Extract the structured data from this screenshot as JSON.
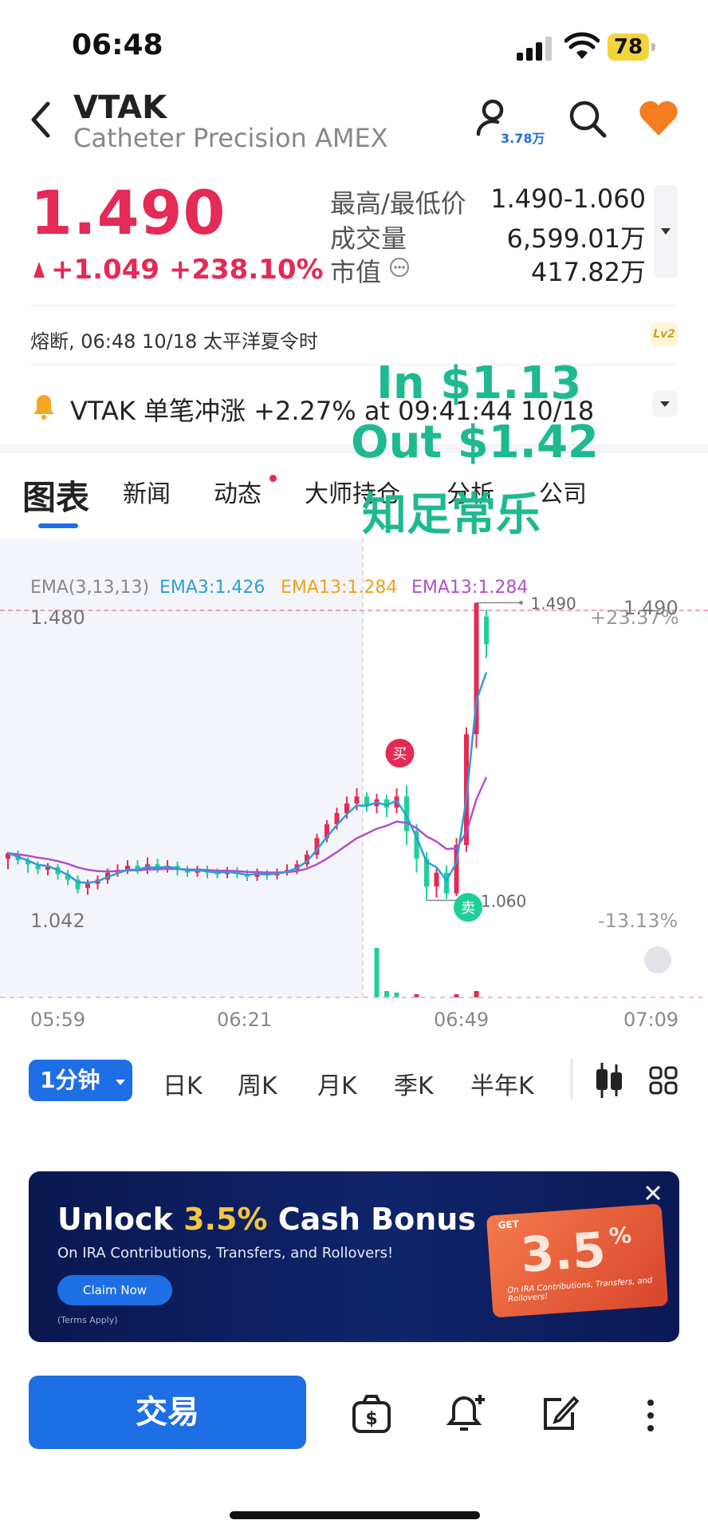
{
  "status_bar": {
    "time": "06:48",
    "battery": "78"
  },
  "header": {
    "ticker": "VTAK",
    "company": "Catheter Precision AMEX",
    "follow_count": "3.78万"
  },
  "quote": {
    "price": "1.490",
    "change": "+1.049 +238.10%",
    "stats": [
      {
        "label": "最高/最低价",
        "value": "1.490-1.060"
      },
      {
        "label": "成交量",
        "value": "6,599.01万"
      },
      {
        "label": "市值",
        "value": "417.82万"
      }
    ]
  },
  "halt_status": "熔断, 06:48 10/18 太平洋夏令时",
  "level_badge": "Lv2",
  "alert_text": "VTAK 单笔冲涨 +2.27% at 09:41:44 10/18",
  "overlay": {
    "line1": "In $1.13",
    "line2": "Out $1.42",
    "line3": "知足常乐"
  },
  "tabs": [
    "图表",
    "新闻",
    "动态",
    "大师持仓",
    "分析",
    "公司"
  ],
  "chart_data": {
    "type": "candlestick",
    "ema_labels": {
      "params": "EMA(3,13,13)",
      "ema3": "EMA3:1.426",
      "ema13a": "EMA13:1.284",
      "ema13b": "EMA13:1.284"
    },
    "ylim": [
      1.042,
      1.48
    ],
    "y_left_labels": [
      "1.480",
      "1.042"
    ],
    "y_right_labels": [
      "+23.37%",
      "-13.13%"
    ],
    "high_marker": "1.490",
    "low_marker": "1.060",
    "buy_label": "买",
    "sell_label": "卖",
    "x_ticks": [
      "05:59",
      "06:21",
      "06:49",
      "07:09"
    ],
    "colors": {
      "up": "#e42a55",
      "down": "#1fcf97",
      "ema3": "#2a9fd6",
      "ema13": "#b24fd0"
    },
    "candles": [
      [
        1.12,
        1.128,
        1.105,
        1.13
      ],
      [
        1.125,
        1.118,
        1.112,
        1.132
      ],
      [
        1.118,
        1.112,
        1.1,
        1.122
      ],
      [
        1.11,
        1.105,
        1.098,
        1.116
      ],
      [
        1.104,
        1.108,
        1.096,
        1.114
      ],
      [
        1.108,
        1.098,
        1.09,
        1.112
      ],
      [
        1.098,
        1.09,
        1.082,
        1.104
      ],
      [
        1.09,
        1.076,
        1.07,
        1.096
      ],
      [
        1.078,
        1.084,
        1.068,
        1.09
      ],
      [
        1.084,
        1.09,
        1.076,
        1.096
      ],
      [
        1.09,
        1.1,
        1.084,
        1.106
      ],
      [
        1.1,
        1.104,
        1.094,
        1.112
      ],
      [
        1.104,
        1.11,
        1.098,
        1.118
      ],
      [
        1.11,
        1.104,
        1.098,
        1.118
      ],
      [
        1.104,
        1.112,
        1.098,
        1.122
      ],
      [
        1.112,
        1.106,
        1.1,
        1.12
      ],
      [
        1.106,
        1.11,
        1.1,
        1.118
      ],
      [
        1.11,
        1.104,
        1.096,
        1.116
      ],
      [
        1.104,
        1.1,
        1.094,
        1.11
      ],
      [
        1.1,
        1.104,
        1.094,
        1.11
      ],
      [
        1.104,
        1.1,
        1.092,
        1.11
      ],
      [
        1.1,
        1.098,
        1.092,
        1.106
      ],
      [
        1.098,
        1.102,
        1.092,
        1.108
      ],
      [
        1.102,
        1.098,
        1.092,
        1.108
      ],
      [
        1.098,
        1.094,
        1.088,
        1.104
      ],
      [
        1.094,
        1.1,
        1.088,
        1.106
      ],
      [
        1.1,
        1.096,
        1.09,
        1.104
      ],
      [
        1.096,
        1.1,
        1.09,
        1.106
      ],
      [
        1.1,
        1.104,
        1.096,
        1.112
      ],
      [
        1.104,
        1.112,
        1.098,
        1.118
      ],
      [
        1.112,
        1.126,
        1.108,
        1.132
      ],
      [
        1.126,
        1.15,
        1.12,
        1.156
      ],
      [
        1.15,
        1.17,
        1.144,
        1.176
      ],
      [
        1.17,
        1.186,
        1.162,
        1.194
      ],
      [
        1.186,
        1.2,
        1.178,
        1.21
      ],
      [
        1.2,
        1.21,
        1.19,
        1.222
      ],
      [
        1.21,
        1.196,
        1.188,
        1.216
      ],
      [
        1.196,
        1.206,
        1.186,
        1.214
      ],
      [
        1.206,
        1.194,
        1.18,
        1.212
      ],
      [
        1.194,
        1.21,
        1.186,
        1.222
      ],
      [
        1.21,
        1.16,
        1.14,
        1.226
      ],
      [
        1.16,
        1.12,
        1.1,
        1.17
      ],
      [
        1.12,
        1.08,
        1.06,
        1.13
      ],
      [
        1.08,
        1.1,
        1.064,
        1.106
      ],
      [
        1.1,
        1.07,
        1.062,
        1.11
      ],
      [
        1.07,
        1.14,
        1.066,
        1.15
      ],
      [
        1.14,
        1.3,
        1.13,
        1.31
      ],
      [
        1.3,
        1.49,
        1.28,
        1.49
      ],
      [
        1.47,
        1.43,
        1.41,
        1.48
      ]
    ]
  },
  "periods": [
    "1分钟",
    "日K",
    "周K",
    "月K",
    "季K",
    "半年K"
  ],
  "banner": {
    "headline_a": "Unlock",
    "headline_b": "3.5%",
    "headline_c": "Cash Bonus",
    "sub": "On IRA Contributions, Transfers, and Rollovers!",
    "cta": "Claim Now",
    "fine": "(Terms Apply)",
    "card_get": "GET",
    "card_value": "3.5",
    "card_pct": "%",
    "card_sub": "On IRA Contributions, Transfers, and Rollovers!"
  },
  "bottom": {
    "trade_label": "交易"
  }
}
